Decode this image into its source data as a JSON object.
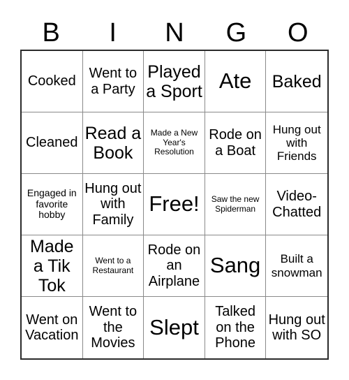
{
  "card": {
    "header_letters": [
      "B",
      "I",
      "N",
      "G",
      "O"
    ],
    "colors": {
      "background": "#ffffff",
      "text": "#000000",
      "grid_inner_line": "#8a8a8a",
      "grid_outer_border": "#2b2b2b"
    },
    "grid_size": "5x5",
    "cells": [
      {
        "text": "Cooked",
        "size": "md"
      },
      {
        "text": "Went to a Party",
        "size": "md"
      },
      {
        "text": "Played a Sport",
        "size": "lg"
      },
      {
        "text": "Ate",
        "size": "xl"
      },
      {
        "text": "Baked",
        "size": "lg"
      },
      {
        "text": "Cleaned",
        "size": "md"
      },
      {
        "text": "Read a Book",
        "size": "lg"
      },
      {
        "text": "Made a New Year's Resolution",
        "size": "xxs"
      },
      {
        "text": "Rode on a Boat",
        "size": "md"
      },
      {
        "text": "Hung out with Friends",
        "size": "sm"
      },
      {
        "text": "Engaged in favorite hobby",
        "size": "xs"
      },
      {
        "text": "Hung out with Family",
        "size": "md"
      },
      {
        "text": "Free!",
        "size": "xl"
      },
      {
        "text": "Saw the new Spiderman",
        "size": "xxs"
      },
      {
        "text": "Video-Chatted",
        "size": "md"
      },
      {
        "text": "Made a Tik Tok",
        "size": "lg"
      },
      {
        "text": "Went to a Restaurant",
        "size": "xxs"
      },
      {
        "text": "Rode on an Airplane",
        "size": "md"
      },
      {
        "text": "Sang",
        "size": "xl"
      },
      {
        "text": "Built a snowman",
        "size": "sm"
      },
      {
        "text": "Went on Vacation",
        "size": "md"
      },
      {
        "text": "Went to the Movies",
        "size": "md"
      },
      {
        "text": "Slept",
        "size": "xl"
      },
      {
        "text": "Talked on the Phone",
        "size": "md"
      },
      {
        "text": "Hung out with SO",
        "size": "md"
      }
    ]
  }
}
